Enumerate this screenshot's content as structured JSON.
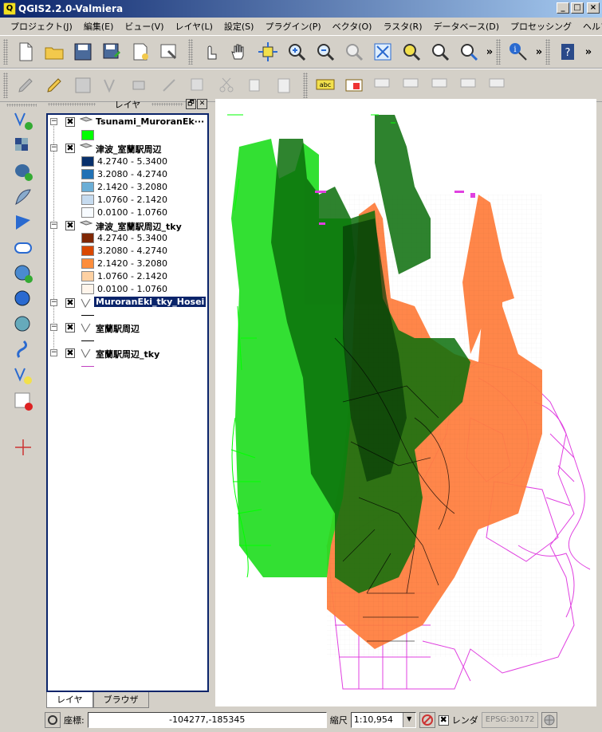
{
  "window": {
    "title": "QGIS2.2.0-Valmiera",
    "app_icon": "Q"
  },
  "menu": [
    "プロジェクト(J)",
    "編集(E)",
    "ビュー(V)",
    "レイヤ(L)",
    "設定(S)",
    "プラグイン(P)",
    "ベクタ(O)",
    "ラスタ(R)",
    "データベース(D)",
    "プロセッシング",
    "ヘルプ(H)"
  ],
  "toolbar_overflow": "»",
  "panel": {
    "title": "レイヤ",
    "float_icon": "🗗",
    "close_icon": "✕",
    "tabs": [
      "レイヤ",
      "ブラウザ"
    ]
  },
  "layers": [
    {
      "name": "Tsunami_MuroranEk···",
      "checked": "✖",
      "expander": "−"
    },
    {
      "name": "津波_室蘭駅周辺",
      "checked": "✖",
      "expander": "−",
      "classes": [
        "4.2740 - 5.3400",
        "3.2080 - 4.2740",
        "2.1420 - 3.2080",
        "1.0760 - 2.1420",
        "0.0100 - 1.0760"
      ],
      "colors": [
        "#08306b",
        "#2171b5",
        "#6baed6",
        "#c6dbef",
        "#f7fbff"
      ]
    },
    {
      "name": "津波_室蘭駅周辺_tky",
      "checked": "✖",
      "expander": "−",
      "classes": [
        "4.2740 - 5.3400",
        "3.2080 - 4.2740",
        "2.1420 - 3.2080",
        "1.0760 - 2.1420",
        "0.0100 - 1.0760"
      ],
      "colors": [
        "#7f2704",
        "#d94801",
        "#fd8d3c",
        "#fdd0a2",
        "#fff5eb"
      ]
    },
    {
      "name": "MuroranEki_tky_Hosei",
      "checked": "✖",
      "expander": "−"
    },
    {
      "name": "室蘭駅周辺",
      "checked": "✖",
      "expander": "−"
    },
    {
      "name": "室蘭駅周辺_tky",
      "checked": "✖",
      "expander": "−"
    }
  ],
  "colors": {
    "green_fill": "#00ff00",
    "green_dark": "#0a6e0a",
    "orange": "#ff8040",
    "magenta": "#e040e0",
    "black_line": "#000000",
    "selection": "#0a246a"
  },
  "status": {
    "coord_label": "座標:",
    "coord_value": "-104277,-185345",
    "scale_label": "縮尺",
    "scale_value": "1:10,954",
    "render_checked": "✖",
    "render_label": "レンダ",
    "epsg": "EPSG:30172"
  }
}
